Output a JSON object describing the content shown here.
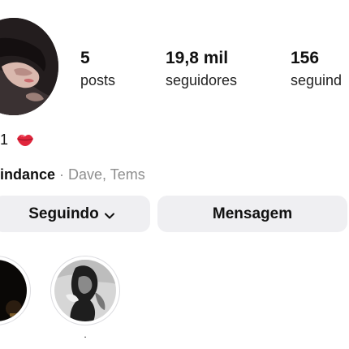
{
  "profile": {
    "avatar_icon": "profile-photo"
  },
  "stats": [
    {
      "value": "5",
      "label": "posts"
    },
    {
      "value": "19,8 mil",
      "label": "seguidores"
    },
    {
      "value": "156",
      "label": "seguind"
    }
  ],
  "bio": {
    "text": "1",
    "emoji_icon": "lips-kiss-icon"
  },
  "music": {
    "song": "indance",
    "separator": "·",
    "artists": "Dave, Tems"
  },
  "actions": {
    "following_label": "Seguindo",
    "message_label": "Mensagem"
  },
  "highlights": [
    {
      "label": ""
    },
    {
      "label": "."
    }
  ],
  "colors": {
    "button_bg": "#efeff2",
    "secondary_text": "#8e8e8e",
    "lips_red": "#e0263c"
  }
}
